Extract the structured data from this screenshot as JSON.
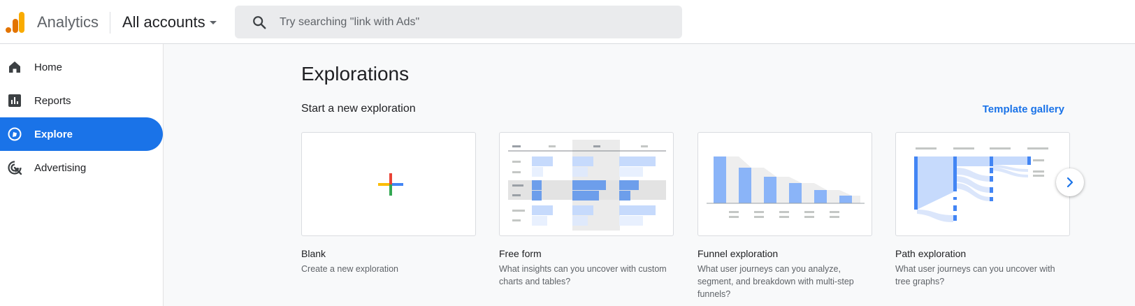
{
  "header": {
    "product_name": "Analytics",
    "account_picker": "All accounts",
    "search_placeholder": "Try searching \"link with Ads\""
  },
  "sidebar": {
    "items": [
      {
        "label": "Home",
        "icon": "home-icon",
        "active": false
      },
      {
        "label": "Reports",
        "icon": "bar-chart-icon",
        "active": false
      },
      {
        "label": "Explore",
        "icon": "explore-icon",
        "active": true
      },
      {
        "label": "Advertising",
        "icon": "advertising-target-icon",
        "active": false
      }
    ]
  },
  "main": {
    "title": "Explorations",
    "section_title": "Start a new exploration",
    "template_gallery_link": "Template gallery",
    "cards": [
      {
        "title": "Blank",
        "description": "Create a new exploration"
      },
      {
        "title": "Free form",
        "description": "What insights can you uncover with custom charts and tables?"
      },
      {
        "title": "Funnel exploration",
        "description": "What user journeys can you analyze, segment, and breakdown with multi-step funnels?"
      },
      {
        "title": "Path exploration",
        "description": "What user journeys can you uncover with tree graphs?"
      }
    ]
  },
  "colors": {
    "accent": "#1a73e8",
    "logo_orange": "#f9ab00",
    "logo_dark_orange": "#e37400"
  }
}
